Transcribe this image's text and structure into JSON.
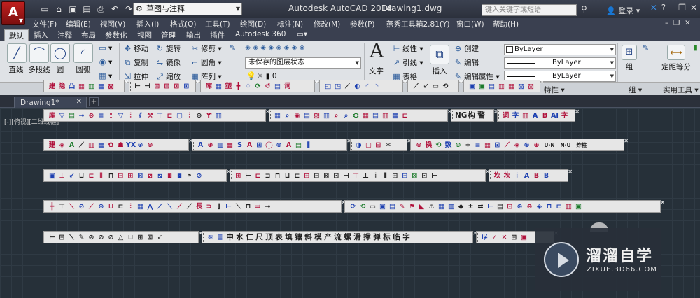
{
  "titlebar": {
    "app_icon_letter": "A",
    "workspace": "草图与注释",
    "title": "Autodesk AutoCAD 2014",
    "file": "Drawing1.dwg",
    "search_placeholder": "键入关键字或短语",
    "login": "登录"
  },
  "menu": [
    "文件(F)",
    "编辑(E)",
    "视图(V)",
    "插入(I)",
    "格式(O)",
    "工具(T)",
    "绘图(D)",
    "标注(N)",
    "修改(M)",
    "参数(P)",
    "燕秀工具箱2.81(Y)",
    "窗口(W)",
    "帮助(H)"
  ],
  "ribbon_tabs": [
    "默认",
    "插入",
    "注释",
    "布局",
    "参数化",
    "视图",
    "管理",
    "输出",
    "插件",
    "Autodesk 360"
  ],
  "ribbon": {
    "draw": [
      "直线",
      "多段线",
      "圆",
      "圆弧"
    ],
    "modify": [
      "移动",
      "旋转",
      "修剪",
      "复制",
      "镜像",
      "圆角",
      "拉伸",
      "缩放",
      "阵列"
    ],
    "layer_state": "未保存的图层状态",
    "layer_zero": "0",
    "text": "文字",
    "annotation": [
      "线性",
      "引线",
      "表格"
    ],
    "insert": "插入",
    "block": [
      "创建",
      "编辑",
      "编辑属性"
    ],
    "bylayer": [
      "ByLayer",
      "ByLayer",
      "ByLayer"
    ],
    "group": "组",
    "measure": "定距等分",
    "panel_titles": [
      "特性",
      "组",
      "实用工具"
    ]
  },
  "doc_tab": "Drawing1*",
  "view_label": "[-][俯视][二维线框]",
  "toolbar_text": {
    "r1": [
      "NG",
      "构",
      "警"
    ],
    "r4a": [
      "U·N",
      "N·U",
      "炸柱"
    ],
    "r5": [
      "中",
      "水",
      "仁",
      "尺",
      "顶",
      "表",
      "填",
      "镶",
      "斜",
      "模",
      "产",
      "流",
      "螺",
      "滑",
      "撑",
      "弹",
      "标",
      "临",
      "字"
    ]
  },
  "watermark": {
    "name": "溜溜自学",
    "url": "ZIXUE.3D66.COM"
  }
}
